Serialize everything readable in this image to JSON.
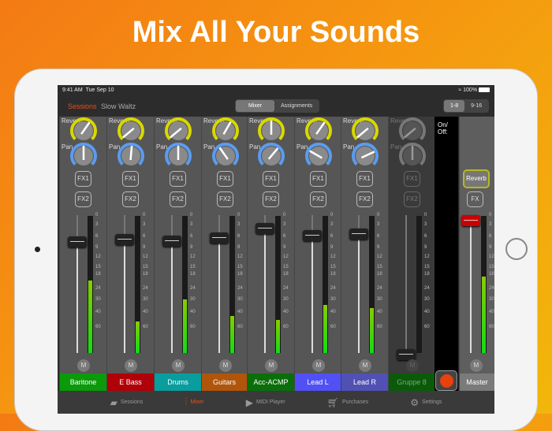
{
  "headline": "Mix All Your Sounds",
  "status": {
    "time": "9:41 AM",
    "date": "Tue Sep 10",
    "battery": "100%"
  },
  "header": {
    "sessions": "Sessions",
    "song": "Slow Waltz",
    "views": [
      "Mixer",
      "Assignments"
    ],
    "active_view": "Mixer",
    "banks": [
      "1-8",
      "9-16"
    ],
    "active_bank": "1-8"
  },
  "labels": {
    "reverb": "Reverb",
    "pan": "Pan",
    "fx1": "FX1",
    "fx2": "FX2",
    "mute": "M",
    "onoff": "On/ Off:",
    "master_reverb": "Reverb",
    "master_fx": "FX"
  },
  "scale": [
    "0",
    "3",
    "6",
    "9",
    "12",
    "15",
    "18",
    "24",
    "30",
    "40",
    "60"
  ],
  "channels": [
    {
      "name": "Baritone",
      "color": "#0a9a0a",
      "reverb": 35,
      "pan": 0,
      "fader": 0.84,
      "level": 0.53
    },
    {
      "name": "E Bass",
      "color": "#b00008",
      "reverb": -130,
      "pan": 5,
      "fader": 0.86,
      "level": 0.23
    },
    {
      "name": "Drums",
      "color": "#0a9d9d",
      "reverb": -130,
      "pan": 0,
      "fader": 0.85,
      "level": 0.39
    },
    {
      "name": "Guitars",
      "color": "#b0550a",
      "reverb": 30,
      "pan": -35,
      "fader": 0.87,
      "level": 0.27
    },
    {
      "name": "Acc-ACMP",
      "color": "#0a6e0a",
      "reverb": 0,
      "pan": 40,
      "fader": 0.94,
      "level": 0.24
    },
    {
      "name": "Lead L",
      "color": "#5050f5",
      "reverb": 35,
      "pan": -60,
      "fader": 0.89,
      "level": 0.35
    },
    {
      "name": "Lead R",
      "color": "#5050b5",
      "reverb": -130,
      "pan": 65,
      "fader": 0.9,
      "level": 0.33
    },
    {
      "name": "Gruppe 8",
      "color": "#0a5a0a",
      "reverb": -130,
      "pan": 0,
      "fader": 0.0,
      "level": 0,
      "disabled": true
    }
  ],
  "master": {
    "name": "Master",
    "color": "#7a7a7a",
    "fader": 1.0,
    "level": 0.56
  },
  "tabs": [
    {
      "label": "Sessions",
      "icon": "sessions-icon"
    },
    {
      "label": "Mixer",
      "icon": "mixer-icon",
      "active": true
    },
    {
      "label": "MIDI Player",
      "icon": "play-icon"
    },
    {
      "label": "Purchases",
      "icon": "cart-icon"
    },
    {
      "label": "Settings",
      "icon": "gear-icon"
    }
  ],
  "colors": {
    "accent": "#e5501c",
    "reverb_arc": "#d8d800",
    "pan_arc": "#5a9cf0"
  }
}
